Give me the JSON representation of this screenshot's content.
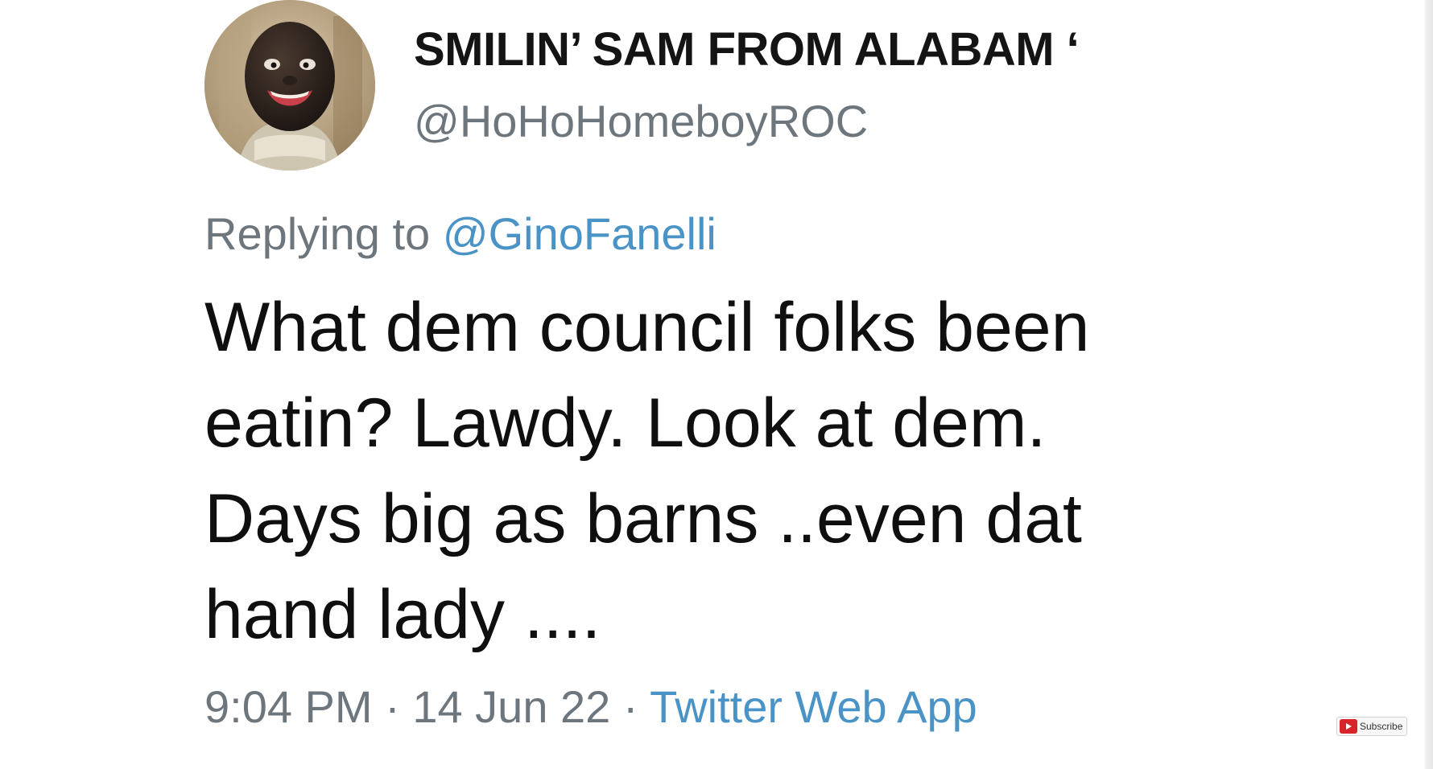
{
  "tweet": {
    "display_name": "SMILIN’ SAM FROM ALABAM ‘",
    "handle": "@HoHoHomeboyROC",
    "replying_prefix": "Replying to ",
    "replying_handle": "@GinoFanelli",
    "body_lines": [
      "What dem council folks been",
      "eatin? Lawdy. Look at dem.",
      "Days big as barns ..even dat",
      "hand lady ...."
    ],
    "time": "9:04 PM",
    "separator": " · ",
    "date": "14 Jun 22",
    "source": "Twitter Web App"
  },
  "overlay": {
    "subscribe_label": "Subscribe",
    "subscribe_icon": "youtube-play-icon"
  },
  "colors": {
    "text_primary": "#0f0f0f",
    "text_secondary": "#6e767d",
    "link": "#4a93c6",
    "youtube_red": "#d8242a"
  }
}
